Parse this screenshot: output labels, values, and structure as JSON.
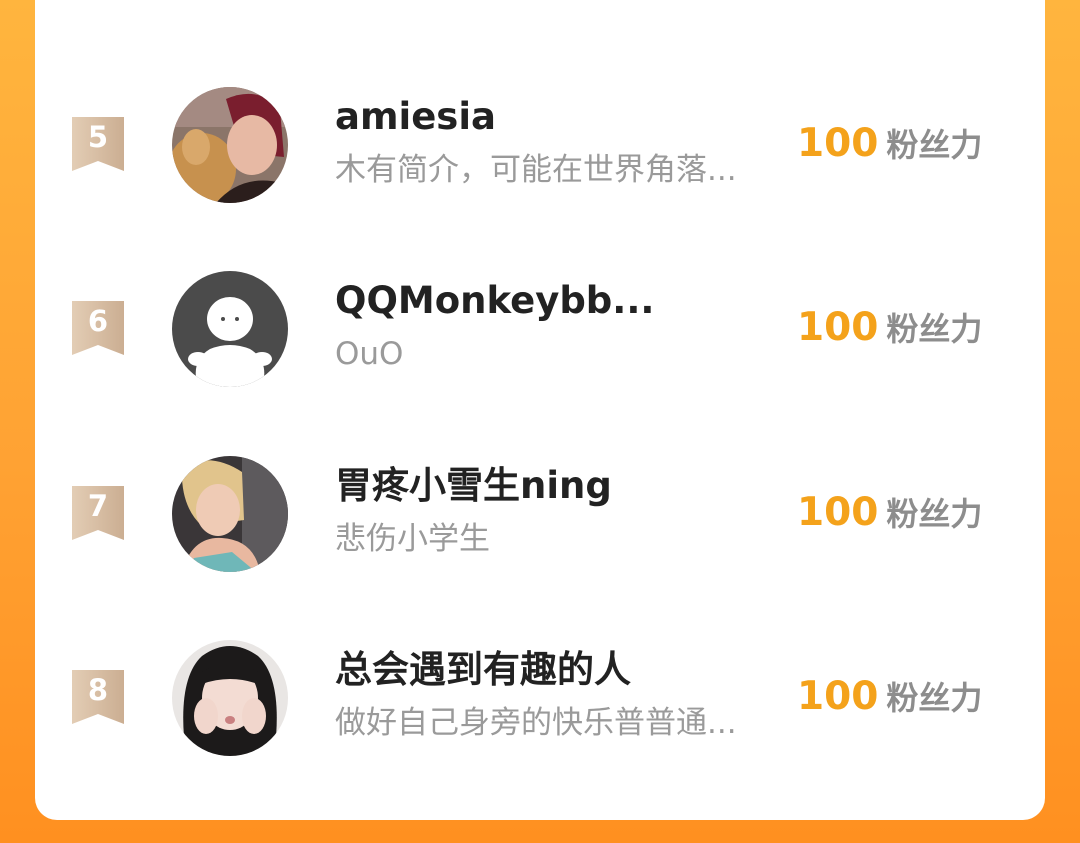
{
  "theme": {
    "background_top": "#FFB53E",
    "background_bottom": "#FF9020",
    "card": "#FFFFFF",
    "score_color": "#F4A21B",
    "badge_color": "#D7BEA4",
    "name_color": "#222222",
    "bio_color": "#9A9A9A"
  },
  "leaderboard": {
    "entries": [
      {
        "rank": "5",
        "name": "amiesia",
        "bio": "木有简介，可能在世界角落...",
        "score": "100",
        "score_unit": "粉丝力",
        "avatar": "photo-avatar-woman-with-cat"
      },
      {
        "rank": "6",
        "name": "QQMonkeybb...",
        "bio": "OuO",
        "score": "100",
        "score_unit": "粉丝力",
        "avatar": "default-avatar-icon"
      },
      {
        "rank": "7",
        "name": "胃疼小雪生ning",
        "bio": "悲伤小学生",
        "score": "100",
        "score_unit": "粉丝力",
        "avatar": "photo-avatar-blonde-girl"
      },
      {
        "rank": "8",
        "name": "总会遇到有趣的人",
        "bio": "做好自己身旁的快乐普普通...",
        "score": "100",
        "score_unit": "粉丝力",
        "avatar": "photo-avatar-girl-hands-on-cheeks"
      }
    ]
  }
}
